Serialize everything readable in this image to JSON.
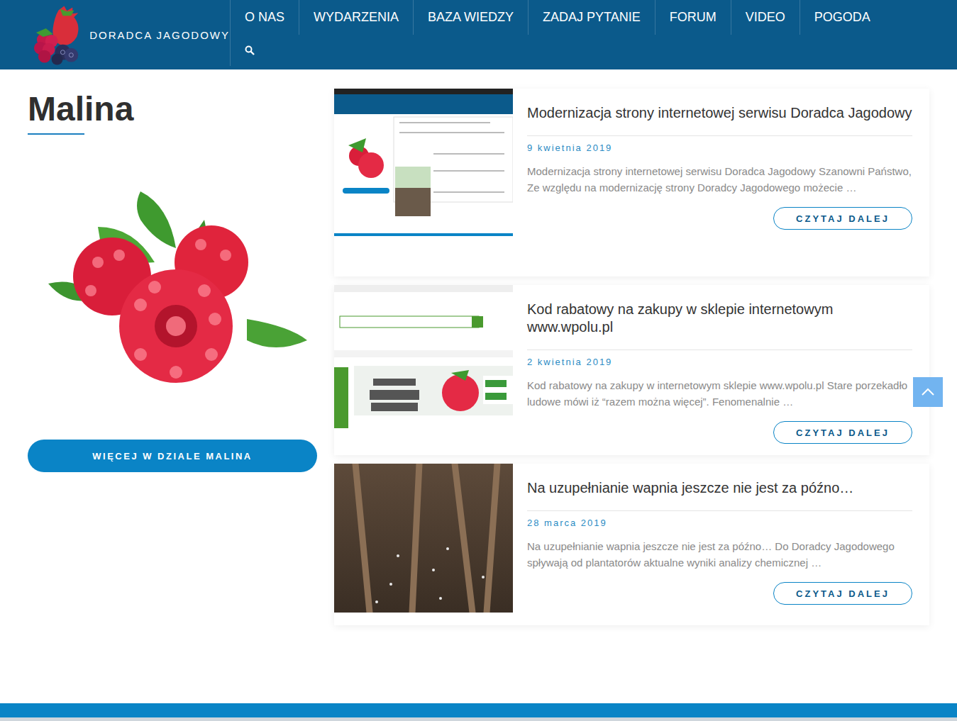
{
  "logo": {
    "text": "DORADCA JAGODOWY"
  },
  "nav": [
    {
      "label": "O NAS"
    },
    {
      "label": "WYDARZENIA"
    },
    {
      "label": "BAZA WIEDZY"
    },
    {
      "label": "ZADAJ PYTANIE"
    },
    {
      "label": "FORUM"
    },
    {
      "label": "VIDEO"
    },
    {
      "label": "POGODA"
    }
  ],
  "section": {
    "title": "Malina",
    "button": "WIĘCEJ W DZIALE MALINA"
  },
  "posts": [
    {
      "title": "Modernizacja strony internetowej serwisu Doradca Jagodowy",
      "date": "9 kwietnia 2019",
      "excerpt": "Modernizacja strony internetowej serwisu Doradca Jagodowy Szanowni Państwo,   Ze względu na modernizację strony Doradcy Jagodowego możecie …",
      "button": "CZYTAJ DALEJ",
      "kind": "site"
    },
    {
      "title": "Kod rabatowy na zakupy w sklepie internetowym www.wpolu.pl",
      "date": "2 kwietnia 2019",
      "excerpt": "Kod rabatowy na zakupy w internetowym sklepie www.wpolu.pl   Stare porzekadło ludowe mówi iż “razem można więcej”. Fenomenalnie …",
      "button": "CZYTAJ DALEJ",
      "kind": "shop"
    },
    {
      "title": "Na uzupełnianie wapnia jeszcze nie jest za późno…",
      "date": "28 marca 2019",
      "excerpt": "Na uzupełnianie wapnia jeszcze nie jest za późno…   Do Doradcy Jagodowego spływają od plantatorów aktualne wyniki analizy chemicznej …",
      "button": "CZYTAJ DALEJ",
      "kind": "photo"
    }
  ]
}
